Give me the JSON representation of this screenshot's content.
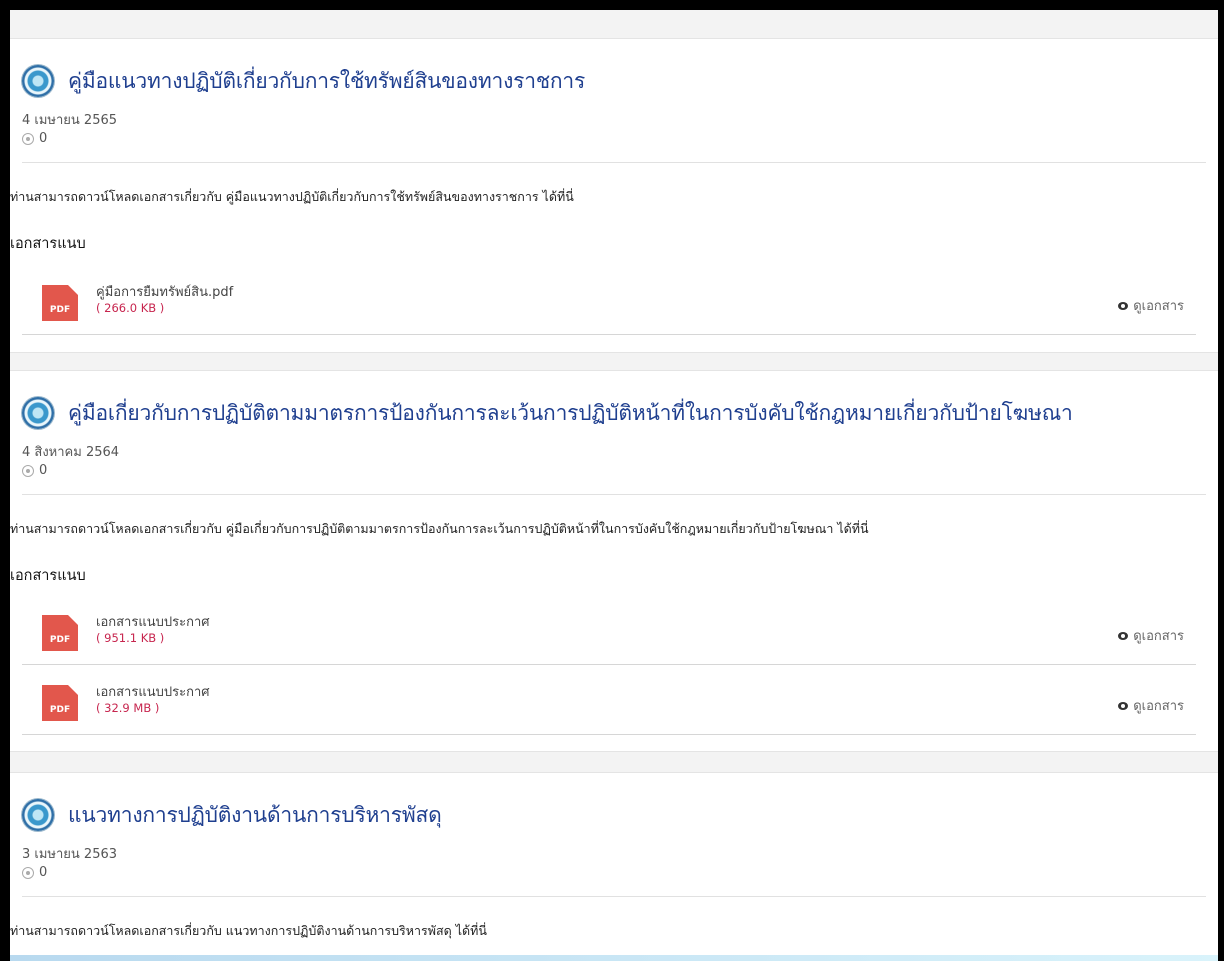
{
  "posts": [
    {
      "title": "คู่มือแนวทางปฏิบัติเกี่ยวกับการใช้ทรัพย์สินของทางราชการ",
      "date": "4 เมษายน 2565",
      "views": "0",
      "description": "ท่านสามารถดาวน์โหลดเอกสารเกี่ยวกับ คู่มือแนวทางปฏิบัติเกี่ยวกับการใช้ทรัพย์สินของทางราชการ ได้ที่นี่",
      "attachments_heading": "เอกสารแนบ",
      "attachments": [
        {
          "icon": "pdf-icon",
          "icon_label": "PDF",
          "name": "คู่มือการยืมทรัพย์สิน.pdf",
          "size": "( 266.0 KB )",
          "action": "ดูเอกสาร"
        }
      ]
    },
    {
      "title": "คู่มือเกี่ยวกับการปฏิบัติตามมาตรการป้องกันการละเว้นการปฏิบัติหน้าที่ในการบังคับใช้กฎหมายเกี่ยวกับป้ายโฆษณา",
      "date": "4 สิงหาคม 2564",
      "views": "0",
      "description": "ท่านสามารถดาวน์โหลดเอกสารเกี่ยวกับ คู่มือเกี่ยวกับการปฏิบัติตามมาตรการป้องกันการละเว้นการปฏิบัติหน้าที่ในการบังคับใช้กฎหมายเกี่ยวกับป้ายโฆษณา ได้ที่นี่",
      "attachments_heading": "เอกสารแนบ",
      "attachments": [
        {
          "icon": "pdf-icon",
          "icon_label": "PDF",
          "name": "เอกสารแนบประกาศ",
          "size": "( 951.1 KB )",
          "action": "ดูเอกสาร"
        },
        {
          "icon": "pdf-icon",
          "icon_label": "PDF",
          "name": "เอกสารแนบประกาศ",
          "size": "( 32.9 MB )",
          "action": "ดูเอกสาร"
        }
      ]
    },
    {
      "title": "แนวทางการปฏิบัติงานด้านการบริหารพัสดุ",
      "date": "3 เมษายน 2563",
      "views": "0",
      "description": "ท่านสามารถดาวน์โหลดเอกสารเกี่ยวกับ แนวทางการปฏิบัติงานด้านการบริหารพัสดุ ได้ที่นี่"
    }
  ],
  "colors": {
    "title": "#1f3f8f",
    "file_size": "#c7254e",
    "pdf_icon": "#e2574c"
  }
}
